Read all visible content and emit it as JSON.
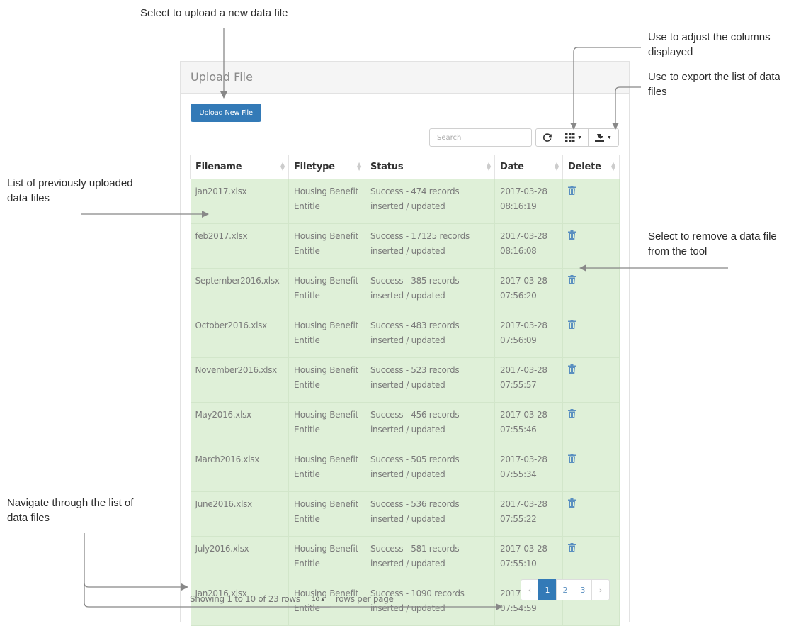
{
  "annotations": {
    "upload": "Select to upload a new data file",
    "columns": "Use to adjust the columns displayed",
    "export": "Use to export the list of data files",
    "list": "List of previously uploaded data files",
    "remove": "Select to remove a data file from the tool",
    "navigate": "Navigate through the list of data files"
  },
  "panel": {
    "title": "Upload File",
    "upload_button": "Upload New File",
    "search_placeholder": "Search"
  },
  "icons": {
    "refresh": "refresh-icon",
    "columns": "columns-icon",
    "export": "export-icon",
    "delete": "trash-icon"
  },
  "colors": {
    "primary": "#337ab7",
    "row_success": "#dff0d8"
  },
  "table": {
    "headers": [
      "Filename",
      "Filetype",
      "Status",
      "Date",
      "Delete"
    ],
    "rows": [
      {
        "filename": "jan2017.xlsx",
        "filetype": "Housing Benefit Entitle",
        "status": "Success - 474 records inserted / updated",
        "date": "2017-03-28 08:16:19"
      },
      {
        "filename": "feb2017.xlsx",
        "filetype": "Housing Benefit Entitle",
        "status": "Success - 17125 records inserted / updated",
        "date": "2017-03-28 08:16:08"
      },
      {
        "filename": "September2016.xlsx",
        "filetype": "Housing Benefit Entitle",
        "status": "Success - 385 records inserted / updated",
        "date": "2017-03-28 07:56:20"
      },
      {
        "filename": "October2016.xlsx",
        "filetype": "Housing Benefit Entitle",
        "status": "Success - 483 records inserted / updated",
        "date": "2017-03-28 07:56:09"
      },
      {
        "filename": "November2016.xlsx",
        "filetype": "Housing Benefit Entitle",
        "status": "Success - 523 records inserted / updated",
        "date": "2017-03-28 07:55:57"
      },
      {
        "filename": "May2016.xlsx",
        "filetype": "Housing Benefit Entitle",
        "status": "Success - 456 records inserted / updated",
        "date": "2017-03-28 07:55:46"
      },
      {
        "filename": "March2016.xlsx",
        "filetype": "Housing Benefit Entitle",
        "status": "Success - 505 records inserted / updated",
        "date": "2017-03-28 07:55:34"
      },
      {
        "filename": "June2016.xlsx",
        "filetype": "Housing Benefit Entitle",
        "status": "Success - 536 records inserted / updated",
        "date": "2017-03-28 07:55:22"
      },
      {
        "filename": "July2016.xlsx",
        "filetype": "Housing Benefit Entitle",
        "status": "Success - 581 records inserted / updated",
        "date": "2017-03-28 07:55:10"
      },
      {
        "filename": "Jan2016.xlsx",
        "filetype": "Housing Benefit Entitle",
        "status": "Success - 1090 records inserted / updated",
        "date": "2017-03-28 07:54:59"
      }
    ]
  },
  "footer": {
    "showing": "Showing 1 to 10 of 23 rows",
    "page_size": "10",
    "rows_per_page": "rows per page"
  },
  "pagination": {
    "prev": "‹",
    "pages": [
      "1",
      "2",
      "3"
    ],
    "active_page": "1",
    "next": "›"
  }
}
